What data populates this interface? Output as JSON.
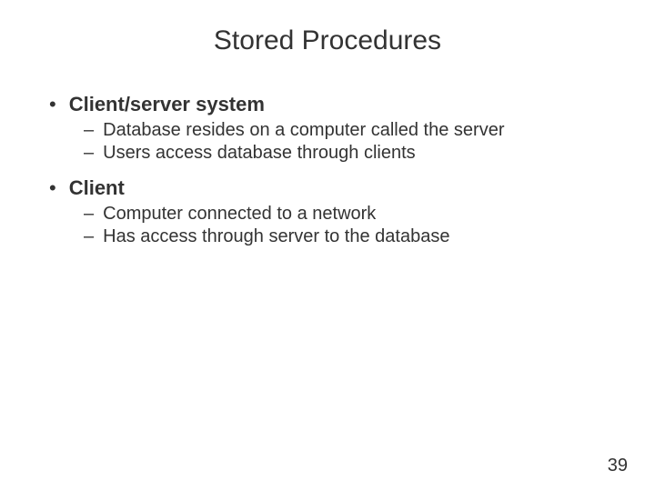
{
  "title": "Stored Procedures",
  "page_number": "39",
  "bullets": [
    {
      "label": "Client/server system",
      "children": [
        "Database resides on a computer called the server",
        "Users access database through clients"
      ]
    },
    {
      "label": "Client",
      "children": [
        "Computer connected to a network",
        "Has access through server to the database"
      ]
    }
  ]
}
